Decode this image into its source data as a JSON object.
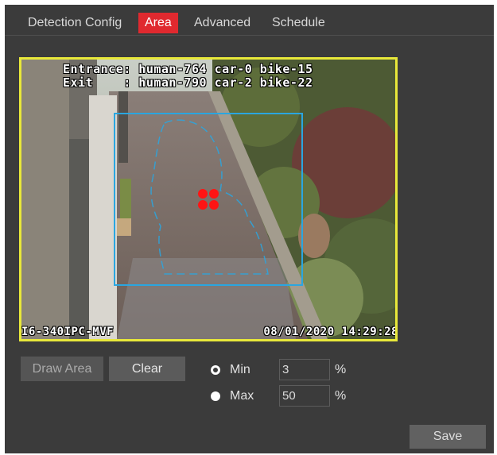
{
  "tabs": [
    {
      "label": "Detection Config",
      "active": false
    },
    {
      "label": "Area",
      "active": true
    },
    {
      "label": "Advanced",
      "active": false
    },
    {
      "label": "Schedule",
      "active": false
    }
  ],
  "video": {
    "osd_line1": "Entrance: human-764 car-0 bike-15",
    "osd_line2": "Exit    : human-790 car-2 bike-22",
    "camera_label": "I6-340IPC-MVF",
    "timestamp": "08/01/2020 14:29:28"
  },
  "buttons": {
    "draw_area": "Draw Area",
    "clear": "Clear",
    "save": "Save"
  },
  "size_filter": {
    "min_label": "Min",
    "max_label": "Max",
    "min_value": "3",
    "max_value": "50",
    "unit": "%",
    "selected": "Min"
  },
  "colors": {
    "active_tab": "#e0292f",
    "detection_rect": "#2aa6e0",
    "video_border": "#e8e83a",
    "target_dots": "#ff1414"
  }
}
